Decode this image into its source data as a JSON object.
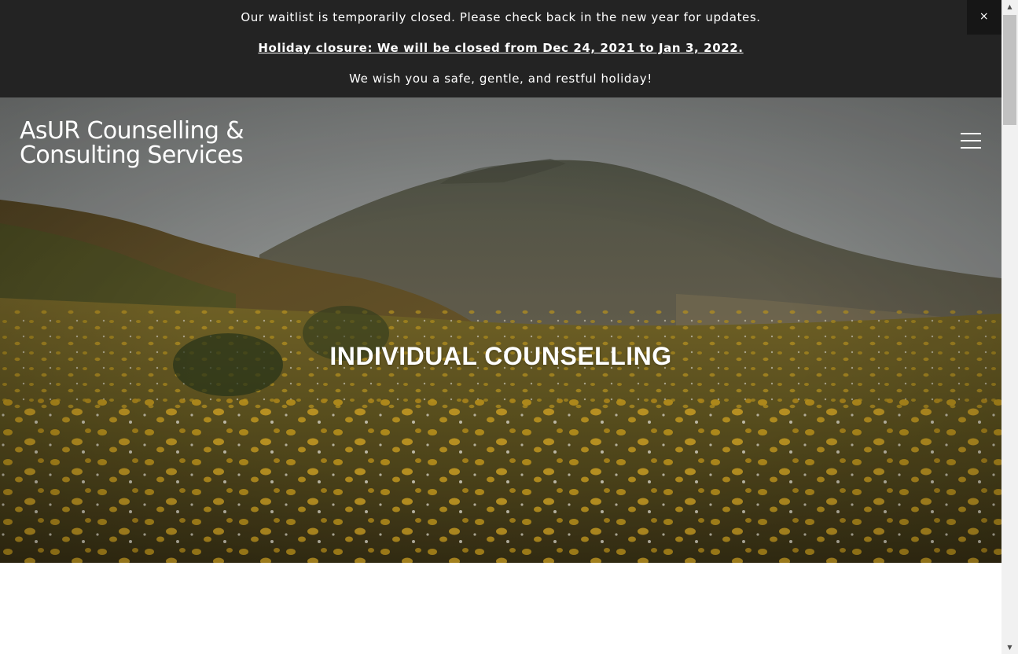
{
  "announcement": {
    "line1": "Our waitlist is temporarily closed. Please check back in the new year for updates.",
    "line2": "Holiday closure: We will be closed from Dec 24, 2021 to Jan 3, 2022. ",
    "line3": "We wish you a safe, gentle, and restful holiday!",
    "close_label": "×"
  },
  "header": {
    "logo_line1": "AsUR Counselling &",
    "logo_line2": "Consulting Services",
    "menu_icon": "hamburger-menu-icon"
  },
  "hero": {
    "title": "INDIVIDUAL COUNSELLING",
    "image": "hillside-wildflower-meadow"
  },
  "scrollbar": {
    "up_arrow": "▲",
    "down_arrow": "▼"
  },
  "colors": {
    "announcement_bg": "#232323",
    "text_light": "#ffffff",
    "page_bg": "#ffffff"
  }
}
